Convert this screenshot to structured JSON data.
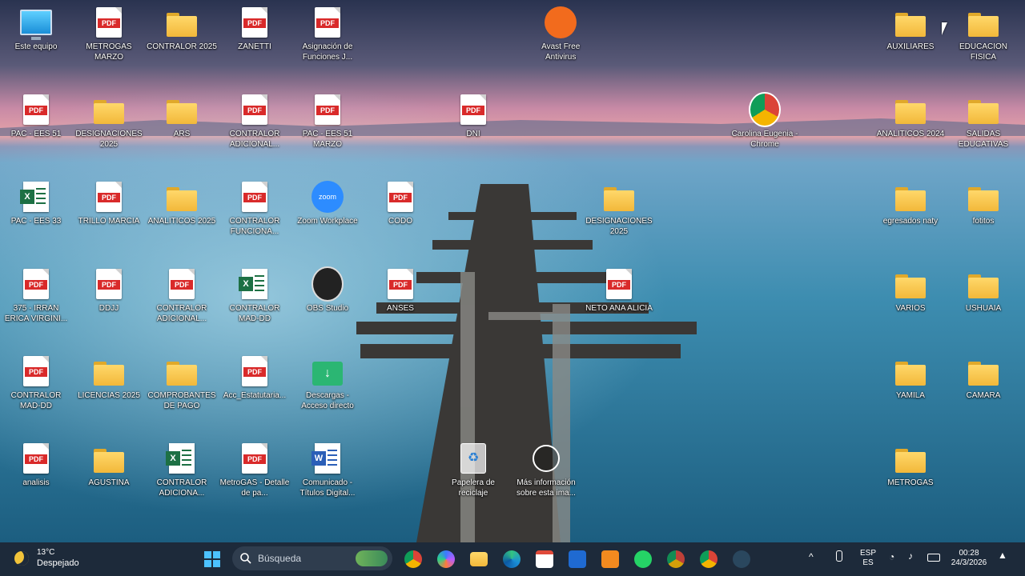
{
  "desktop": {
    "icons": [
      {
        "label": "Este equipo",
        "type": "monitor"
      },
      {
        "label": "METROGAS MARZO",
        "type": "pdf"
      },
      {
        "label": "CONTRALOR 2025",
        "type": "folder"
      },
      {
        "label": "ZANETTI",
        "type": "pdf"
      },
      {
        "label": "Asignación de Funciones J...",
        "type": "pdf"
      },
      {
        "label": "Avast Free Antivirus",
        "type": "avast"
      },
      {
        "label": "AUXILIARES",
        "type": "folder"
      },
      {
        "label": "EDUCACION FISICA",
        "type": "folder"
      },
      {
        "label": "PAC - EES 51",
        "type": "pdf"
      },
      {
        "label": "DESIGNACIONES 2025",
        "type": "folder"
      },
      {
        "label": "ARS",
        "type": "folder"
      },
      {
        "label": "CONTRALOR ADICIONAL...",
        "type": "pdf"
      },
      {
        "label": "PAC - EES 51 MARZO",
        "type": "pdf"
      },
      {
        "label": "DNI",
        "type": "pdf"
      },
      {
        "label": "Carolina Eugenia - Chrome",
        "type": "chrome"
      },
      {
        "label": "ANALITICOS 2024",
        "type": "folder"
      },
      {
        "label": "SALIDAS EDUCATIVAS",
        "type": "folder"
      },
      {
        "label": "PAC - EES 33",
        "type": "excel"
      },
      {
        "label": "TRILLO MARCIA",
        "type": "pdf"
      },
      {
        "label": "ANALITICOS 2025",
        "type": "folder"
      },
      {
        "label": "CONTRALOR FUNCIONA...",
        "type": "pdf"
      },
      {
        "label": "Zoom Workplace",
        "type": "zoom"
      },
      {
        "label": "CODO",
        "type": "pdf"
      },
      {
        "label": "DESIGNACIONES 2025",
        "type": "folder"
      },
      {
        "label": "egresados naty",
        "type": "folder"
      },
      {
        "label": "fotitos",
        "type": "folder"
      },
      {
        "label": "375 - IRRAN ERICA VIRGINI...",
        "type": "pdf"
      },
      {
        "label": "DDJJ",
        "type": "pdf"
      },
      {
        "label": "CONTRALOR ADICIONAL...",
        "type": "pdf"
      },
      {
        "label": "CONTRALOR MAD-DD",
        "type": "excel"
      },
      {
        "label": "OBS Studio",
        "type": "obs"
      },
      {
        "label": "ANSES",
        "type": "pdf"
      },
      {
        "label": "NETO ANA ALICIA",
        "type": "pdf"
      },
      {
        "label": "VARIOS",
        "type": "folder"
      },
      {
        "label": "USHUAIA",
        "type": "folder"
      },
      {
        "label": "CONTRALOR MAD-DD",
        "type": "pdf"
      },
      {
        "label": "LICENCIAS 2025",
        "type": "folder"
      },
      {
        "label": "COMPROBANTES DE PAGO",
        "type": "folder"
      },
      {
        "label": "Acc_Estatutaria...",
        "type": "pdf"
      },
      {
        "label": "Descargas - Acceso directo",
        "type": "downloads"
      },
      {
        "label": "YAMILA",
        "type": "folder"
      },
      {
        "label": "CAMARA",
        "type": "folder"
      },
      {
        "label": "analisis",
        "type": "pdf"
      },
      {
        "label": "AGUSTINA",
        "type": "folder"
      },
      {
        "label": "CONTRALOR ADICIONA...",
        "type": "excel"
      },
      {
        "label": "MetroGAS - Detalle de pa...",
        "type": "pdf"
      },
      {
        "label": "Comunicado - Títulos Digital...",
        "type": "word"
      },
      {
        "label": "Papelera de reciclaje",
        "type": "recycle"
      },
      {
        "label": "Más información sobre esta ima...",
        "type": "info"
      },
      {
        "label": "METROGAS",
        "type": "folder"
      }
    ],
    "pdf_badge": "PDF"
  },
  "taskbar": {
    "weather_temp": "13°C",
    "weather_desc": "Despejado",
    "search_placeholder": "Búsqueda",
    "lang_top": "ESP",
    "lang_bottom": "ES",
    "time": "00:28",
    "date": "24/3/2026"
  },
  "colors": {
    "taskbar": "#1d2a3a",
    "pdf_red": "#d92a2a",
    "folder_yellow": "#f2b83a"
  }
}
